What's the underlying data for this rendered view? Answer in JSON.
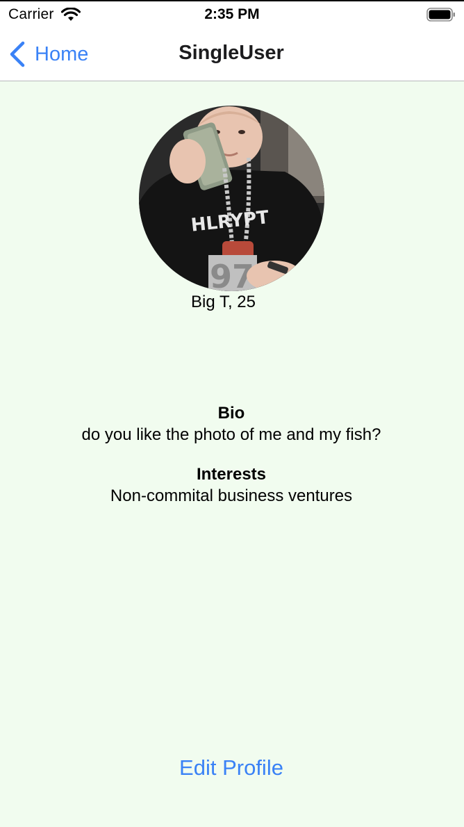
{
  "status_bar": {
    "carrier": "Carrier",
    "time": "2:35 PM",
    "wifi_icon": "wifi-icon",
    "battery_icon": "battery-icon"
  },
  "nav": {
    "back_label": "Home",
    "back_icon": "chevron-left-icon",
    "title": "SingleUser"
  },
  "profile": {
    "photo": "profile-photo",
    "name_age": "Big T, 25",
    "bio_heading": "Bio",
    "bio_text": "do you like the photo of me and my fish?",
    "interests_heading": "Interests",
    "interests_text": "Non-commital business ventures"
  },
  "actions": {
    "edit_profile_label": "Edit Profile"
  },
  "colors": {
    "accent": "#3a82f6",
    "background": "#f1fcef",
    "nav_background": "#ffffff"
  }
}
